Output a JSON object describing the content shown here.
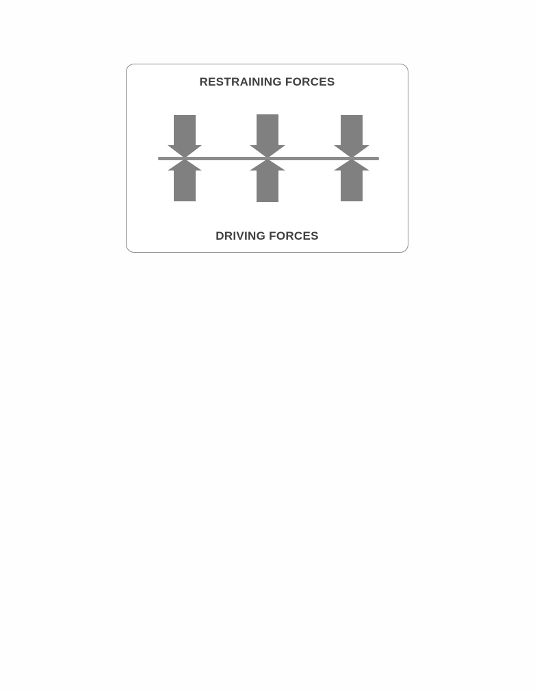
{
  "diagram": {
    "restraining_label": "RESTRAINING FORCES",
    "driving_label": "DRIVING FORCES",
    "colors": {
      "arrow": "#808080",
      "line": "#8c8c8c",
      "border": "#8a8a8a",
      "text": "#3f3f3f"
    },
    "pairs": 3
  }
}
